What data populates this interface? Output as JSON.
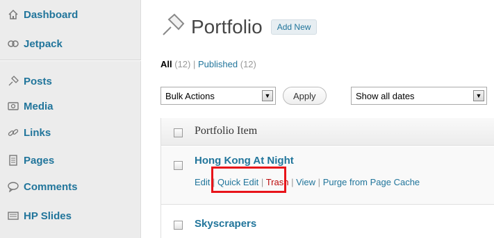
{
  "sidebar": {
    "items": [
      {
        "label": "Dashboard",
        "icon": "house-icon"
      },
      {
        "label": "Jetpack",
        "icon": "jetpack-icon"
      },
      {
        "label": "Posts",
        "icon": "pushpin-icon"
      },
      {
        "label": "Media",
        "icon": "media-icon"
      },
      {
        "label": "Links",
        "icon": "links-icon"
      },
      {
        "label": "Pages",
        "icon": "pages-icon"
      },
      {
        "label": "Comments",
        "icon": "comments-icon"
      },
      {
        "label": "HP Slides",
        "icon": "slides-icon"
      }
    ]
  },
  "header": {
    "title": "Portfolio",
    "add_new": "Add New"
  },
  "filters": {
    "all_label": "All",
    "all_count": "(12)",
    "separator": "|",
    "published_label": "Published",
    "published_count": "(12)"
  },
  "toolbar": {
    "bulk_actions": "Bulk Actions",
    "apply": "Apply",
    "dates": "Show all dates"
  },
  "table": {
    "column_header": "Portfolio Item",
    "rows": [
      {
        "title": "Hong Kong At Night",
        "actions": {
          "edit": "Edit",
          "quick_edit": "Quick Edit",
          "trash": "Trash",
          "view": "View",
          "purge": "Purge from Page Cache",
          "sep": "|"
        }
      },
      {
        "title": "Skyscrapers"
      }
    ]
  },
  "colors": {
    "link": "#21759b",
    "trash": "#bc0b0b",
    "highlight": "#e8141a"
  }
}
